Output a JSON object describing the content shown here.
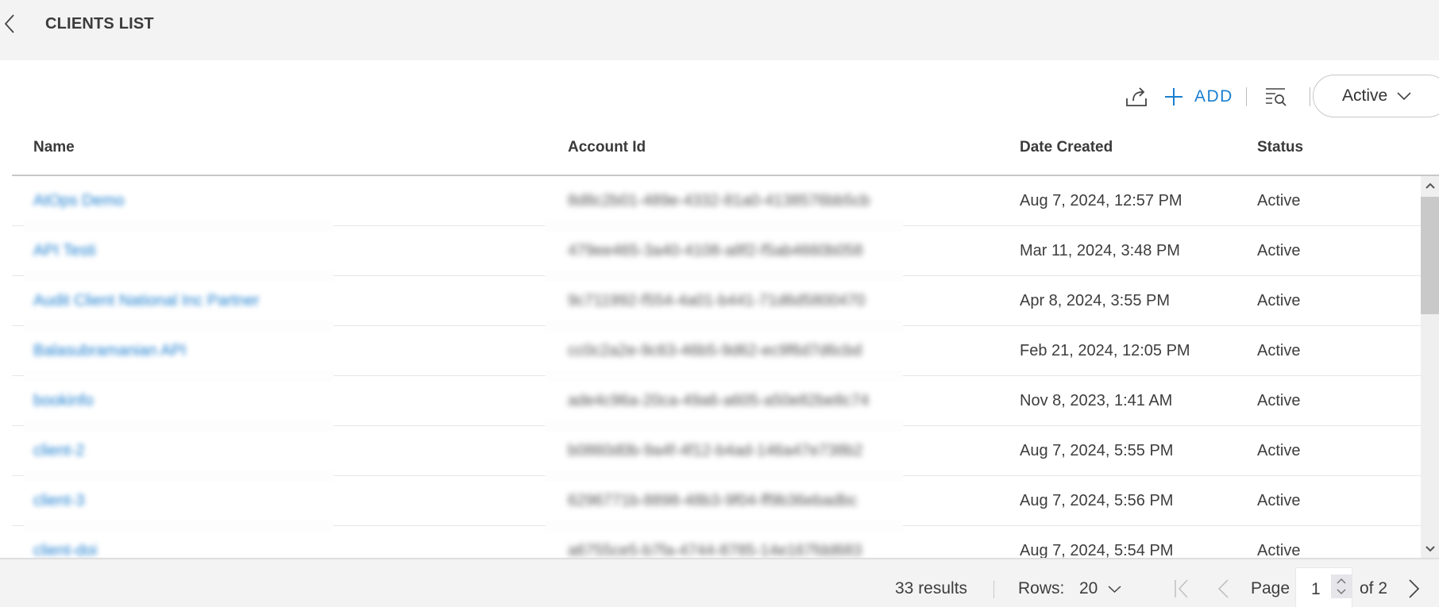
{
  "header": {
    "title": "CLIENTS LIST",
    "back_icon": "chevron-left-icon"
  },
  "toolbar": {
    "export_icon": "share-export-icon",
    "add_label": "ADD",
    "add_icon": "plus-icon",
    "filter_icon": "filter-search-icon",
    "status_filter_value": "Active"
  },
  "table": {
    "columns": [
      "Name",
      "Account Id",
      "Date Created",
      "Status"
    ],
    "rows": [
      {
        "name": "AtOps Demo",
        "account_id": "8d8c2b01-489e-4332-81a0-4138576bb5cb",
        "date_created": "Aug 7, 2024, 12:57 PM",
        "status": "Active"
      },
      {
        "name": "API Testi",
        "account_id": "479ee465-3a40-4108-a8f2-f5ab4660b058",
        "date_created": "Mar 11, 2024, 3:48 PM",
        "status": "Active"
      },
      {
        "name": "Audit Client National Inc Partner",
        "account_id": "9c711992-f554-4a01-b441-71d6d5800470",
        "date_created": "Apr 8, 2024, 3:55 PM",
        "status": "Active"
      },
      {
        "name": "Balasubramanian API",
        "account_id": "cc0c2a2e-9c63-46b5-9d62-ec9f6d7d6cbd",
        "date_created": "Feb 21, 2024, 12:05 PM",
        "status": "Active"
      },
      {
        "name": "bookinfo",
        "account_id": "ade4c96a-20ca-49a6-a605-a50e82be8c74",
        "date_created": "Nov 8, 2023, 1:41 AM",
        "status": "Active"
      },
      {
        "name": "client-2",
        "account_id": "b0860d0b-9a4f-4f12-b4ad-146a47e738b2",
        "date_created": "Aug 7, 2024, 5:55 PM",
        "status": "Active"
      },
      {
        "name": "client-3",
        "account_id": "6296771b-8898-48b3-9f04-ff9b36ebadbc",
        "date_created": "Aug 7, 2024, 5:56 PM",
        "status": "Active"
      },
      {
        "name": "client-doi",
        "account_id": "a6755ce5-b7fa-4744-8785-14e167fdd683",
        "date_created": "Aug 7, 2024, 5:54 PM",
        "status": "Active"
      }
    ]
  },
  "footer": {
    "results": "33 results",
    "rows_label": "Rows:",
    "rows_value": "20",
    "page_label": "Page",
    "page_value": "1",
    "page_of": "of 2"
  }
}
